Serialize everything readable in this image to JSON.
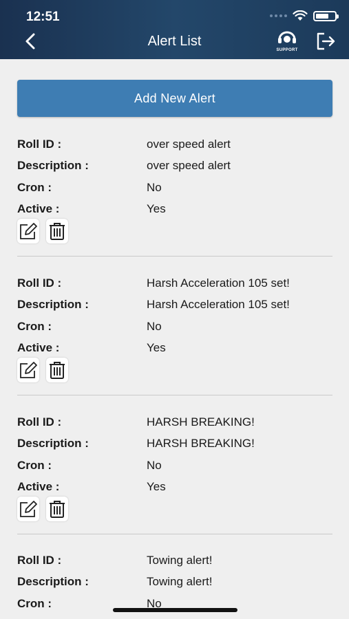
{
  "status_bar": {
    "time": "12:51"
  },
  "header": {
    "title": "Alert List",
    "support_label": "SUPPORT"
  },
  "add_button_label": "Add New Alert",
  "labels": {
    "roll_id": "Roll ID :",
    "description": "Description :",
    "cron": "Cron :",
    "active": "Active :"
  },
  "alerts": [
    {
      "roll_id": "over speed alert",
      "description": "over speed alert",
      "cron": "No",
      "active": "Yes"
    },
    {
      "roll_id": "Harsh Acceleration 105 set!",
      "description": "Harsh Acceleration 105 set!",
      "cron": "No",
      "active": "Yes"
    },
    {
      "roll_id": "HARSH BREAKING!",
      "description": "HARSH BREAKING!",
      "cron": "No",
      "active": "Yes"
    },
    {
      "roll_id": "Towing alert!",
      "description": "Towing alert!",
      "cron": "No",
      "active": ""
    }
  ],
  "icons": {
    "back": "chevron-left-icon",
    "support": "support-icon",
    "logout": "logout-icon",
    "edit": "edit-icon",
    "delete": "trash-icon"
  }
}
